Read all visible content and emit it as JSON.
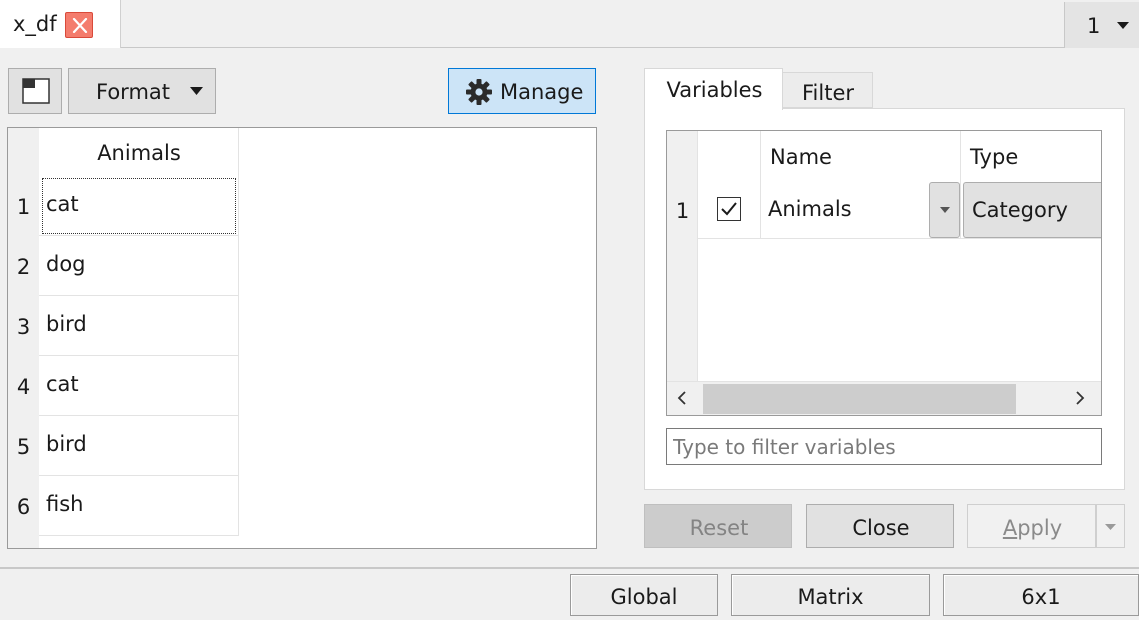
{
  "window": {
    "tab_title": "x_df",
    "page_selector_value": "1"
  },
  "toolbar": {
    "layout_button_icon": "layout-icon",
    "format_label": "Format",
    "manage_label": "Manage",
    "manage_icon": "gear-icon"
  },
  "table": {
    "columns": [
      "Animals"
    ],
    "rows": [
      {
        "num": "1",
        "value": "cat"
      },
      {
        "num": "2",
        "value": "dog"
      },
      {
        "num": "3",
        "value": "bird"
      },
      {
        "num": "4",
        "value": "cat"
      },
      {
        "num": "5",
        "value": "bird"
      },
      {
        "num": "6",
        "value": "fish"
      }
    ],
    "focused_row": 1
  },
  "panel": {
    "tabs": [
      {
        "label": "Variables",
        "active": true
      },
      {
        "label": "Filter",
        "active": false
      }
    ],
    "variables": {
      "headers": {
        "name": "Name",
        "type": "Type"
      },
      "rows": [
        {
          "num": "1",
          "checked": true,
          "name": "Animals",
          "type": "Category"
        }
      ]
    },
    "filter_placeholder": "Type to filter variables"
  },
  "buttons": {
    "reset": "Reset",
    "close": "Close",
    "apply_mnemonic": "A",
    "apply_rest": "pply"
  },
  "status": {
    "scope": "Global",
    "kind": "Matrix",
    "size": "6x1"
  },
  "colors": {
    "accent": "#0078d7",
    "accent_fill": "#cce4f7",
    "close_tab": "#f47c6d"
  }
}
